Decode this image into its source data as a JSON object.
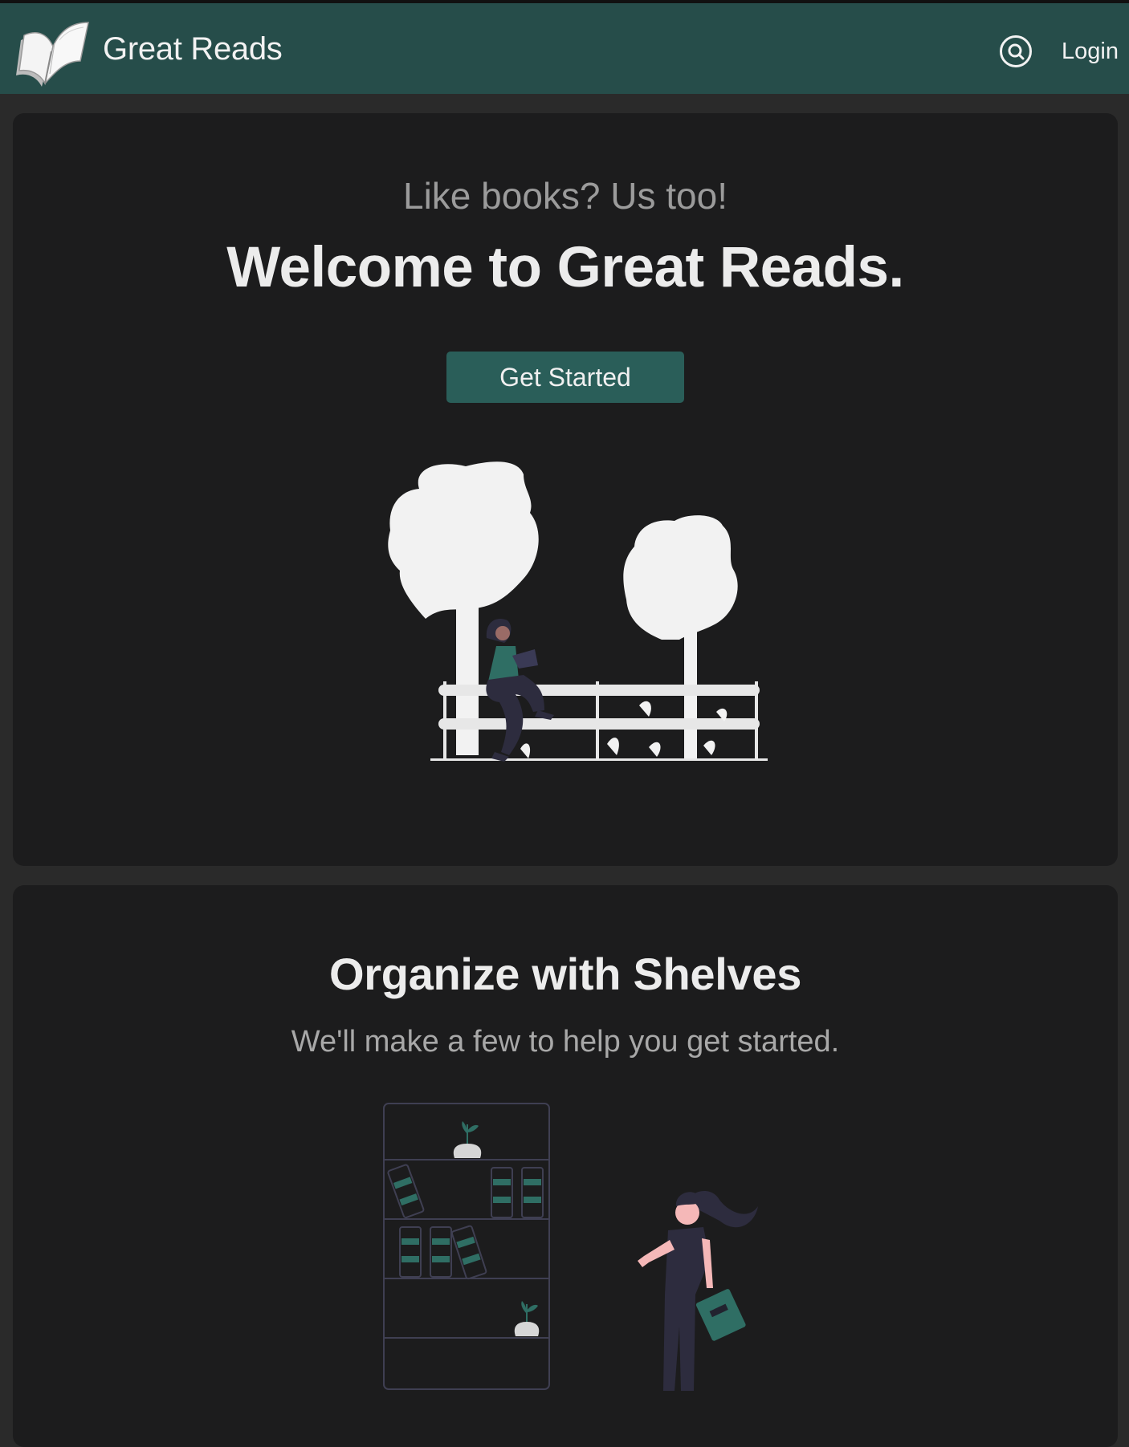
{
  "navbar": {
    "brand": "Great Reads",
    "login_label": "Login",
    "search_icon": "search-icon",
    "logo_icon": "open-book-icon",
    "background": "#264d4a"
  },
  "hero": {
    "tagline": "Like books? Us too!",
    "headline": "Welcome to Great Reads.",
    "cta_label": "Get Started",
    "illustration": "woman-reading-on-fence-illustration"
  },
  "shelves": {
    "title": "Organize with Shelves",
    "subtitle": "We'll make a few to help you get started.",
    "illustration": "woman-with-bookshelf-illustration"
  },
  "colors": {
    "page_bg": "#2a2a2a",
    "card_bg": "#1c1c1d",
    "accent": "#2a5e59",
    "book_green": "#2f6e64"
  }
}
